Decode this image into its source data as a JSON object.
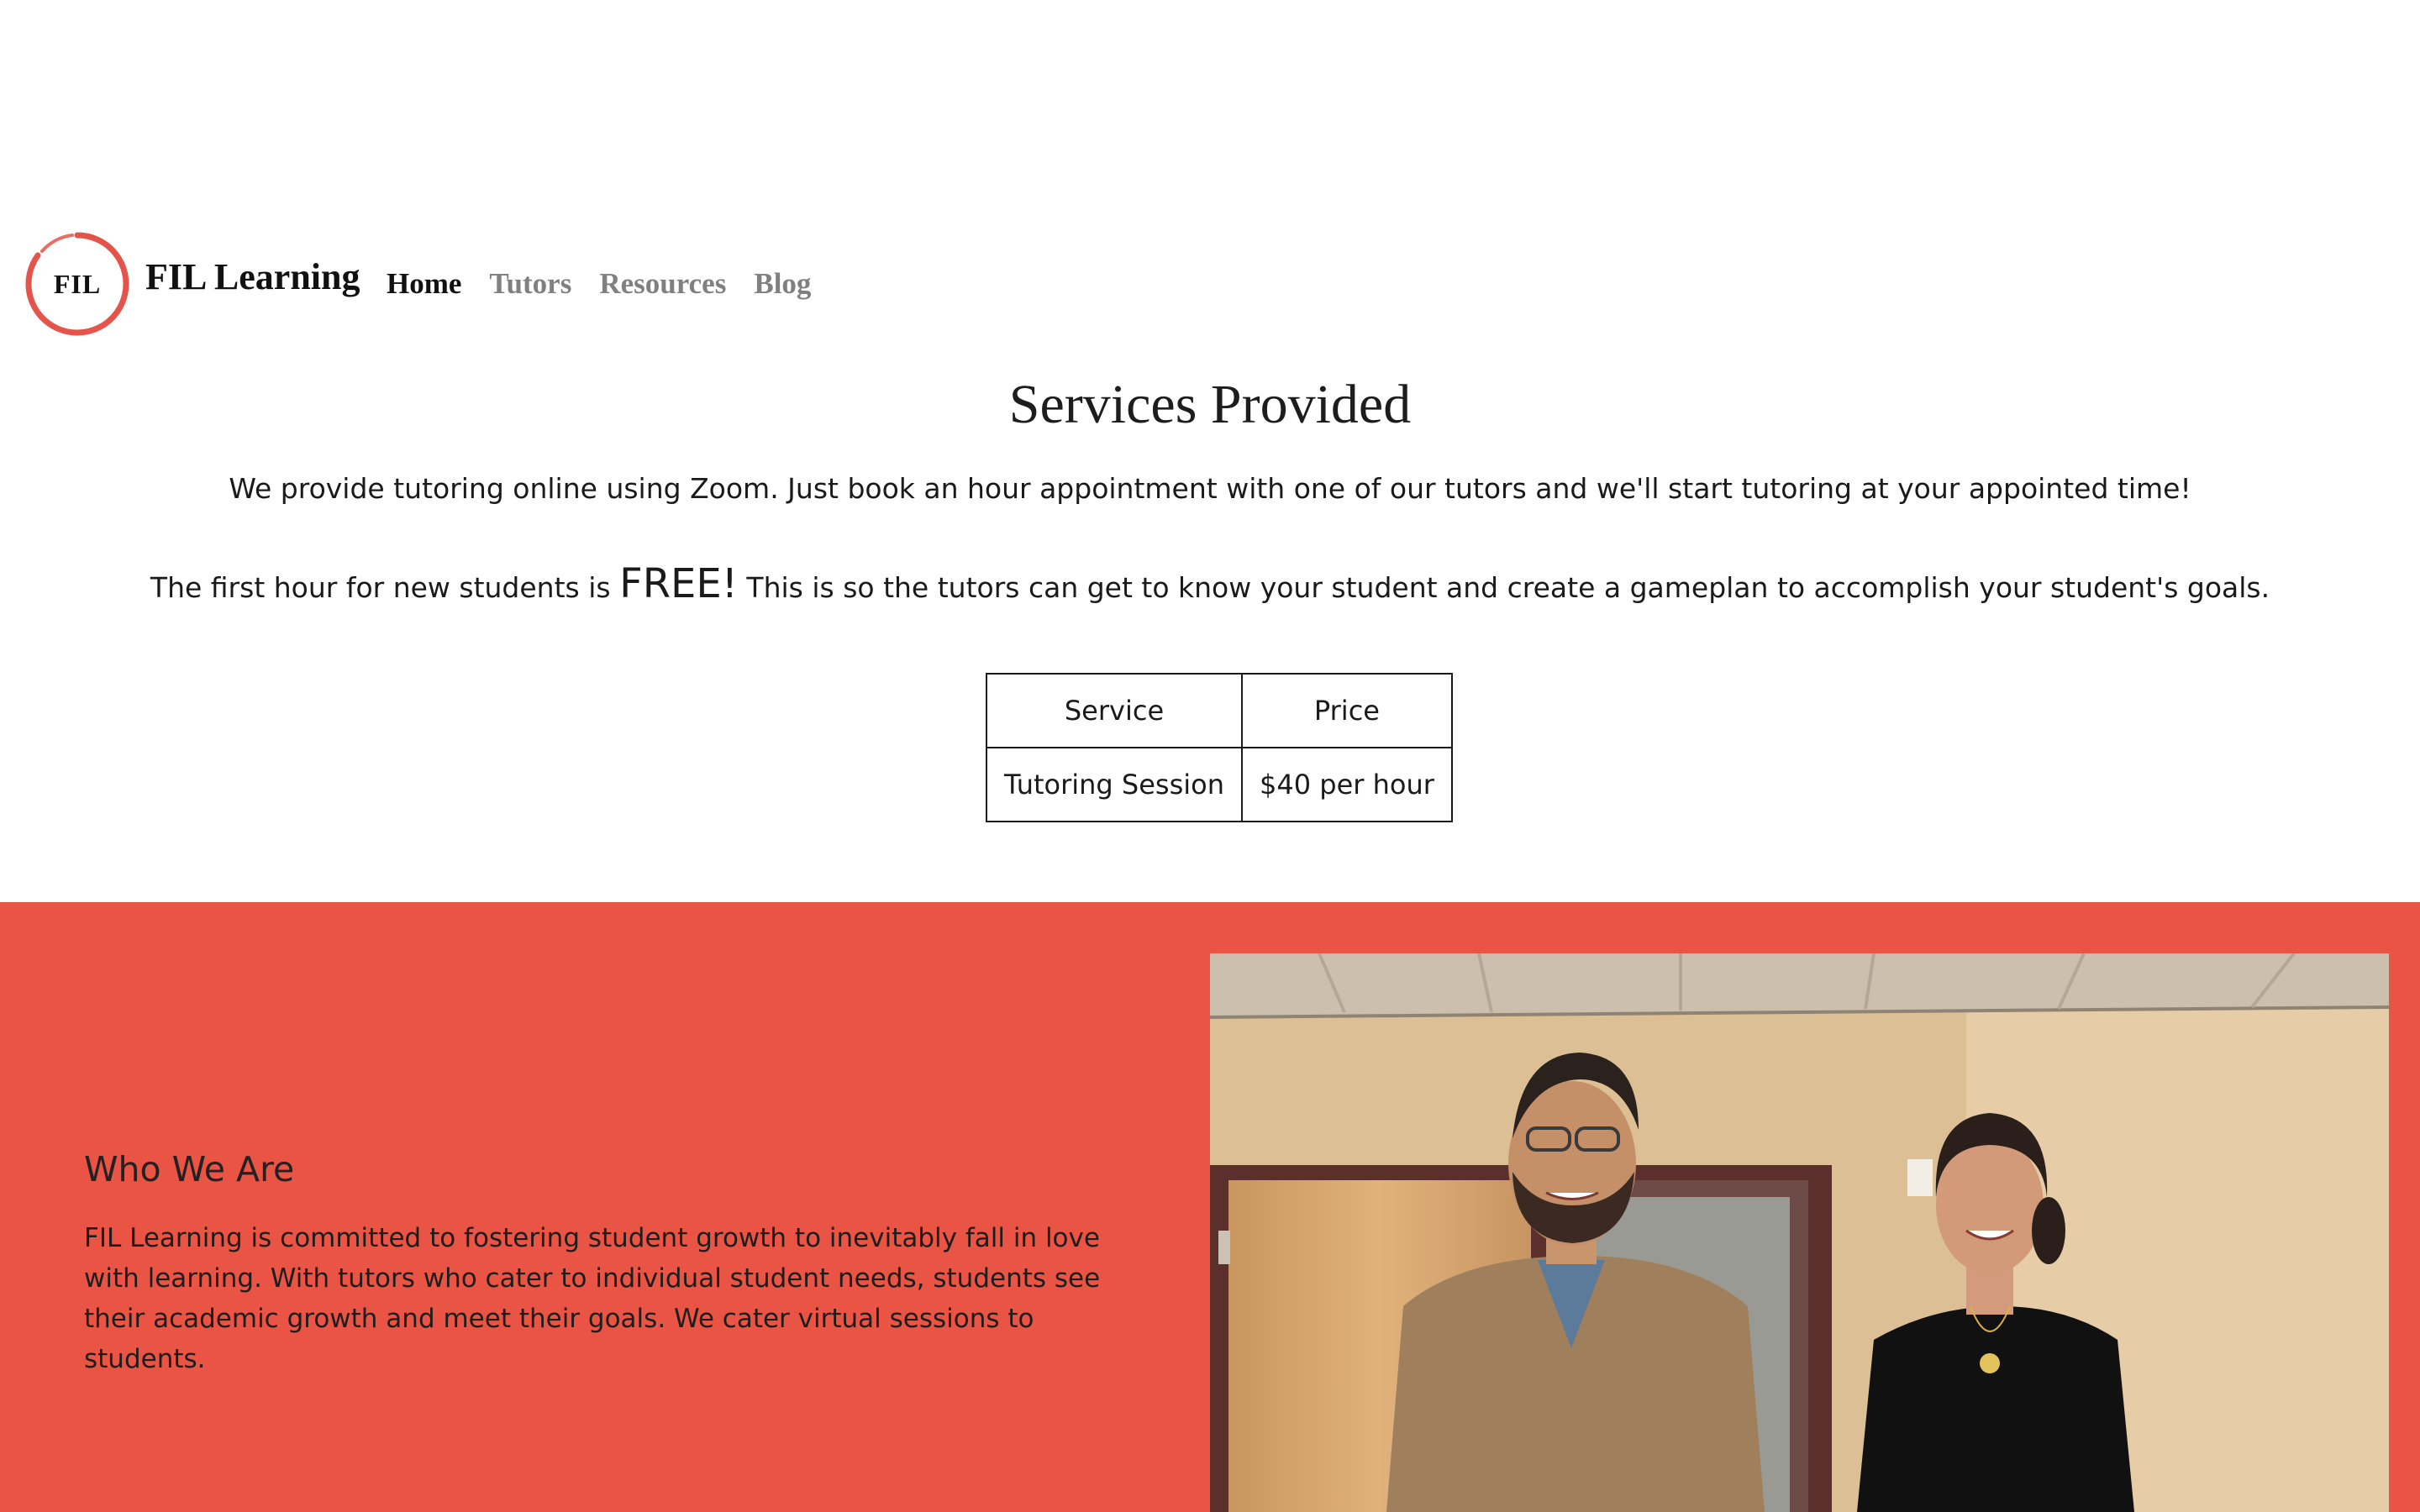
{
  "header": {
    "logo_mark": "FIL",
    "brand": "FIL Learning",
    "brand_color": "#e4544a"
  },
  "nav": {
    "items": [
      {
        "label": "Home",
        "active": true
      },
      {
        "label": "Tutors",
        "active": false
      },
      {
        "label": "Resources",
        "active": false
      },
      {
        "label": "Blog",
        "active": false
      }
    ]
  },
  "services": {
    "title": "Services Provided",
    "intro": "We provide tutoring online using Zoom. Just book an hour appointment with one of our tutors and we'll start tutoring at your appointed time!",
    "free_prefix": "The first hour for new students is ",
    "free_word": "FREE!",
    "free_suffix": " This is so the tutors can get to know your student and create a gameplan to accomplish your student's goals.",
    "table": {
      "headers": [
        "Service",
        "Price"
      ],
      "rows": [
        [
          "Tutoring Session",
          "$40 per hour"
        ]
      ]
    }
  },
  "about": {
    "heading": "Who We Are",
    "body": "FIL Learning is committed to fostering student growth to inevitably fall in love with learning. With tutors who cater to individual student needs, students see their academic growth and meet their goals. We cater virtual sessions to students.",
    "background_color": "#e95444"
  },
  "photo": {
    "subject": "two-tutors-smiling-photo"
  }
}
